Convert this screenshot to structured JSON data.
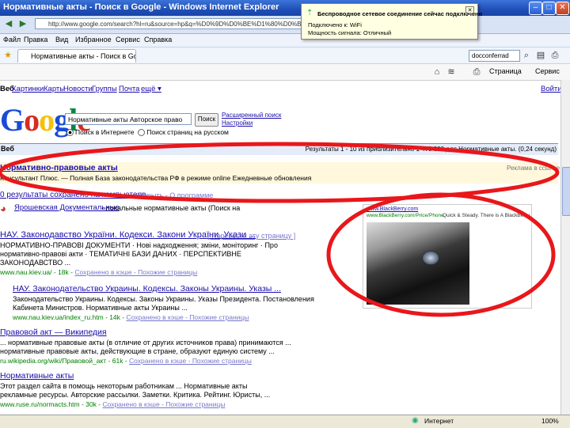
{
  "window": {
    "title": "Нормативные акты - Поиск в Google - Windows Internet Explorer",
    "address": "http://www.google.com/search?hl=ru&source=hp&q=%D0%9D%D0%BE%D1%80%D0%BC%D0%B0%D1%82%D0%B8%D0%B2%D0%BD%D1%8B%D0%B5..."
  },
  "menu": [
    "Файл",
    "Правка",
    "Вид",
    "Избранное",
    "Сервис",
    "Справка"
  ],
  "tab": {
    "label": "Нормативные акты - Поиск в Google"
  },
  "toolbar": {
    "search_box": "docconferrad",
    "page_label": "Страница",
    "tools_label": "Сервис"
  },
  "popup": {
    "title": "Беспроводное сетевое соединение сейчас подключено",
    "line1": "Подключено к: WiFi",
    "line2": "Мощность сигнала: Отличный"
  },
  "google_nav": {
    "items": [
      "Веб",
      "Картинки",
      "Карты",
      "Новости",
      "Группы",
      "Почта",
      "ещё ▾"
    ],
    "signin": "Войти"
  },
  "search": {
    "query": "Нормативные акты Авторское право",
    "button": "Поиск",
    "advanced": "Расширенный поиск",
    "settings": "Настройки",
    "radio_web": "Поиск в Интернете",
    "radio_ru": "Поиск страниц на русском"
  },
  "results_bar": {
    "left": "Веб",
    "right": "Результаты 1 - 10 из приблизительно 1 470 000 для Нормативные акты. (0,24 секунд)"
  },
  "sponsored": {
    "title": "Нормативно-правовые акты",
    "snippet": "Консультант Плюс. — Полная База законодательства РФ в режиме online Ежедневные обновления",
    "label": "Реклама в ссылке"
  },
  "results": [
    {
      "title": "0 результаты сохранено на компьютере",
      "links": "- Скрыть - О программе"
    },
    {
      "title": "Ярошевская Документальные",
      "snippet": "- локальные нормативные акты (Поиск на"
    },
    {
      "title": "НАУ. Законодавство України. Кодекси. Закони України. Укази ...",
      "translate": "[ Перевести эту страницу ]",
      "snippet1": "НОРМАТИВНО-ПРАВОВІ ДОКУМЕНТИ · Нові надходження; зміни, моніторинг · Про",
      "snippet2": "нормативно-правові акти · ТЕМАТИЧНІ БАЗИ ДАНИХ · ПЕРСПЕКТИВНЕ",
      "snippet3": "ЗАКОНОДАВСТВО ...",
      "url": "www.nau.kiev.ua/ - 18k -",
      "cache": "Сохранено в кэше - Похожие страницы"
    },
    {
      "title": "НАУ. Законодательство Украины. Кодексы. Законы Украины. Указы ...",
      "snippet1": "Законодательство Украины. Кодексы. Законы Украины. Указы Президента. Постановления",
      "snippet2": "Кабинета Министров. Нормативные акты Украины ...",
      "url": "www.nau.kiev.ua/index_ru.htm - 14k -",
      "cache": "Сохранено в кэше - Похожие страницы"
    },
    {
      "title": "Правовой акт — Википедия",
      "snippet1": "... нормативные правовые акты (в отличие от других источников права) принимаются ...",
      "snippet2": "нормативные правовые акты, действующие в стране, образуют единую систему ...",
      "url": "ru.wikipedia.org/wiki/Правовой_акт - 61k -",
      "cache": "Сохранено в кэше - Похожие страницы"
    },
    {
      "title": "Нормативные акты",
      "snippet1": "Этот раздел сайта в помощь некоторым работникам ... Нормативные акты",
      "snippet2": "рекламные ресурсы. Авторские рассылки. Заметки. Критика. Рейтинг. Юристы, ...",
      "url": "www.ruse.ru/normacts.htm - 30k -",
      "cache": "Сохранено в кэше - Похожие страницы"
    }
  ],
  "image_ad": {
    "header": "www.BlackBerry.com",
    "line": "www.BlackBerry.com/Price/Phone",
    "caption": "Quick & Steady. There is A BlackBerry"
  },
  "status": {
    "zone": "Интернет",
    "zoom": "100%"
  },
  "colors": {
    "highlight": "#e8171b",
    "link": "#1a0dab",
    "titlebar": "#1f4fb8"
  }
}
